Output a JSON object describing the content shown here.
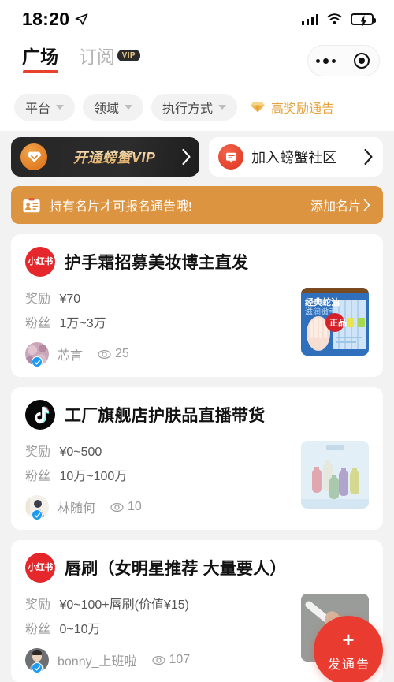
{
  "status_bar": {
    "time": "18:20",
    "location_icon": "location-arrow-icon",
    "signal_icon": "cellular-signal-icon",
    "wifi_icon": "wifi-icon",
    "battery_icon": "battery-charging-icon",
    "battery_level": 62
  },
  "header": {
    "tabs": [
      {
        "label": "广场",
        "active": true
      },
      {
        "label": "订阅",
        "active": false,
        "badge": "VIP"
      }
    ],
    "capsule": {
      "menu_icon": "more-dots-icon",
      "close_icon": "target-circle-icon"
    }
  },
  "filters": [
    {
      "label": "平台",
      "type": "dropdown"
    },
    {
      "label": "领域",
      "type": "dropdown"
    },
    {
      "label": "执行方式",
      "type": "dropdown"
    },
    {
      "label": "高奖励通告",
      "type": "highlight",
      "icon": "diamond-icon",
      "color": "#e6a23c"
    }
  ],
  "banners": {
    "vip": {
      "label": "开通螃蟹VIP",
      "icon": "diamond-coin-icon",
      "chevron": "chevron-right-icon"
    },
    "community": {
      "label": "加入螃蟹社区",
      "icon": "chat-bubble-icon",
      "chevron": "chevron-right-icon"
    }
  },
  "notice": {
    "icon": "id-card-icon",
    "text": "持有名片才可报名通告哦!",
    "action": "添加名片",
    "chevron": "chevron-right-icon"
  },
  "cards": [
    {
      "platform": "小红书",
      "platform_key": "xhs",
      "title": "护手霜招募美妆博主直发",
      "reward_label": "奖励",
      "reward_value": "¥70",
      "fans_label": "粉丝",
      "fans_value": "1万~3万",
      "author": "芯言",
      "verified": true,
      "views": "25",
      "views_icon": "eye-icon"
    },
    {
      "platform": "抖音",
      "platform_key": "douyin",
      "title": "工厂旗舰店护肤品直播带货",
      "reward_label": "奖励",
      "reward_value": "¥0~500",
      "fans_label": "粉丝",
      "fans_value": "10万~100万",
      "author": "林随何",
      "verified": true,
      "views": "10",
      "views_icon": "eye-icon"
    },
    {
      "platform": "小红书",
      "platform_key": "xhs",
      "title": "唇刷（女明星推荐 大量要人）",
      "reward_label": "奖励",
      "reward_value": "¥0~100+唇刷(价值¥15)",
      "fans_label": "粉丝",
      "fans_value": "0~10万",
      "author": "bonny_上班啦",
      "verified": true,
      "views": "107",
      "views_icon": "eye-icon"
    }
  ],
  "fab": {
    "plus": "+",
    "label": "发通告",
    "color": "#ea3b30"
  }
}
